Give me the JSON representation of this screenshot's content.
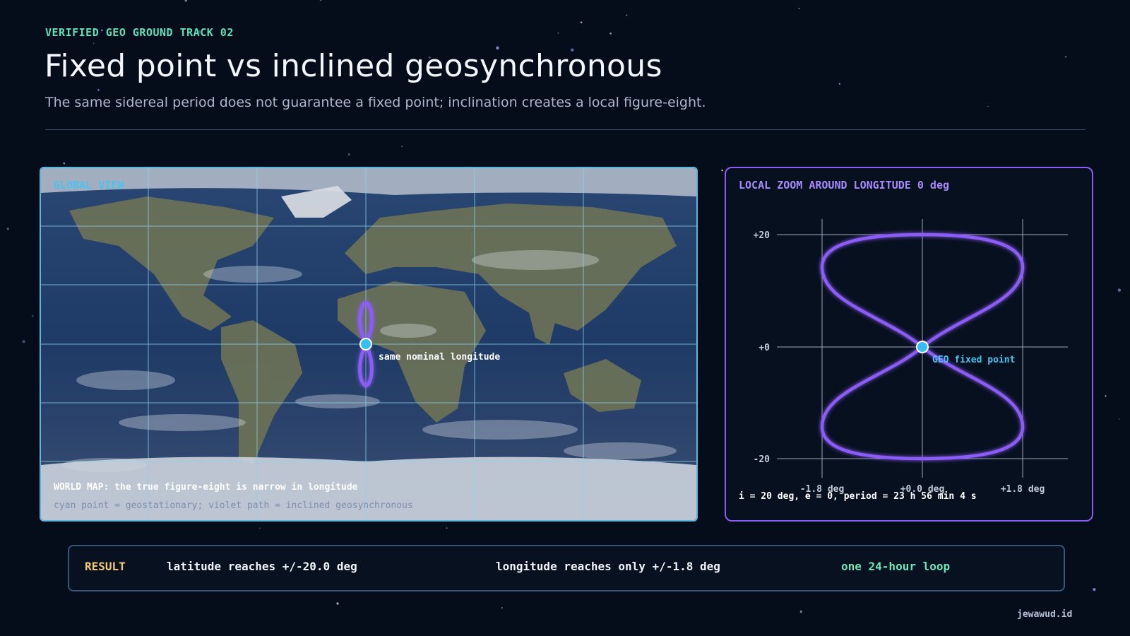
{
  "header": {
    "kicker": "VERIFIED GEO GROUND TRACK 02",
    "title": "Fixed point vs inclined geosynchronous",
    "subtitle": "The same sidereal period does not guarantee a fixed point; inclination creates a local figure-eight."
  },
  "global_view": {
    "label": "GLOBAL VIEW",
    "point_label": "same nominal longitude",
    "footnote_primary": "WORLD MAP: the true figure-eight is narrow in longitude",
    "footnote_secondary": "cyan point = geostationary; violet path = inclined geosynchronous"
  },
  "local_zoom": {
    "label": "LOCAL ZOOM AROUND LONGITUDE 0 deg",
    "y_ticks": [
      "+20",
      "+0",
      "-20"
    ],
    "x_ticks": [
      "-1.8 deg",
      "+0.0 deg",
      "+1.8 deg"
    ],
    "fixed_point_label": "GEO fixed point",
    "params": "i = 20 deg, e = 0, period = 23 h 56 min 4 s"
  },
  "result": {
    "tag": "RESULT",
    "latitude": "latitude reaches +/-20.0 deg",
    "longitude": "longitude reaches only +/-1.8 deg",
    "loop": "one 24-hour loop"
  },
  "footer": {
    "credit": "jewawud.id"
  },
  "colors": {
    "background": "#050d1b",
    "accent_green": "#5ee0b8",
    "cyan": "#4cc3ee",
    "violet": "#8b5cf6",
    "result_tag": "#f7c873"
  },
  "icons": {
    "geo_point": "cyan-dot-icon",
    "track": "figure-eight-path"
  }
}
